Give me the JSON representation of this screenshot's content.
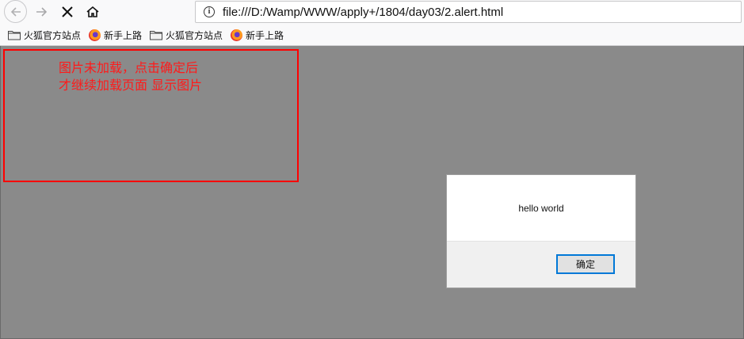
{
  "browser": {
    "url": "file:///D:/Wamp/WWW/apply+/1804/day03/2.alert.html",
    "icons": {
      "back": "back-arrow-icon",
      "forward": "forward-arrow-icon",
      "stop": "stop-x-icon",
      "home": "home-icon",
      "info": "info-icon"
    }
  },
  "bookmarks": [
    {
      "label": "火狐官方站点",
      "icon": "folder-icon"
    },
    {
      "label": "新手上路",
      "icon": "firefox-icon"
    },
    {
      "label": "火狐官方站点",
      "icon": "folder-icon"
    },
    {
      "label": "新手上路",
      "icon": "firefox-icon"
    }
  ],
  "page": {
    "red_text_line1": "图片未加载，点击确定后",
    "red_text_line2": "才继续加载页面 显示图片",
    "border_color": "#ff0000",
    "text_color": "#ff1a1a"
  },
  "dialog": {
    "message": "hello world",
    "ok_label": "确定",
    "accent": "#0078d7"
  }
}
